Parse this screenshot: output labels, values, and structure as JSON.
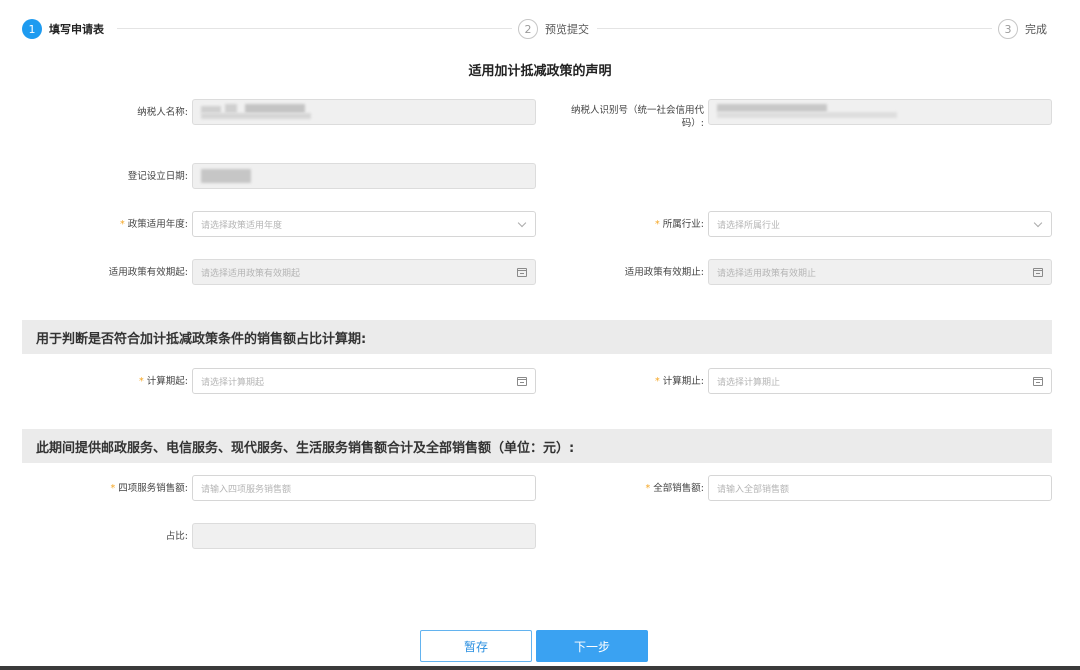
{
  "steps": [
    {
      "num": "1",
      "label": "填写申请表"
    },
    {
      "num": "2",
      "label": "预览提交"
    },
    {
      "num": "3",
      "label": "完成"
    }
  ],
  "page_title": "适用加计抵减政策的声明",
  "form": {
    "taxpayer_name": {
      "label": "纳税人名称:"
    },
    "taxpayer_id": {
      "label_line1": "纳税人识别号（统一社会信用代",
      "label_line2": "码）:"
    },
    "reg_date": {
      "label": "登记设立日期:"
    },
    "policy_year": {
      "label": "政策适用年度:",
      "placeholder": "请选择政策适用年度"
    },
    "industry": {
      "label": "所属行业:",
      "placeholder": "请选择所属行业"
    },
    "valid_start": {
      "label": "适用政策有效期起:",
      "placeholder": "请选择适用政策有效期起"
    },
    "valid_end": {
      "label": "适用政策有效期止:",
      "placeholder": "请选择适用政策有效期止"
    }
  },
  "section1": {
    "title": "用于判断是否符合加计抵减政策条件的销售额占比计算期:",
    "calc_start": {
      "label": "计算期起:",
      "placeholder": "请选择计算期起"
    },
    "calc_end": {
      "label": "计算期止:",
      "placeholder": "请选择计算期止"
    }
  },
  "section2": {
    "title": "此期间提供邮政服务、电信服务、现代服务、生活服务销售额合计及全部销售额（单位：元）:",
    "four_sales": {
      "label": "四项服务销售额:",
      "placeholder": "请输入四项服务销售额"
    },
    "total_sales": {
      "label": "全部销售额:",
      "placeholder": "请输入全部销售额"
    },
    "ratio": {
      "label": "占比:"
    }
  },
  "required_mark": "*",
  "buttons": {
    "save": "暂存",
    "next": "下一步"
  },
  "colors": {
    "primary": "#1e9bf0",
    "required": "#f5a623",
    "section_bg": "#ebebeb"
  }
}
